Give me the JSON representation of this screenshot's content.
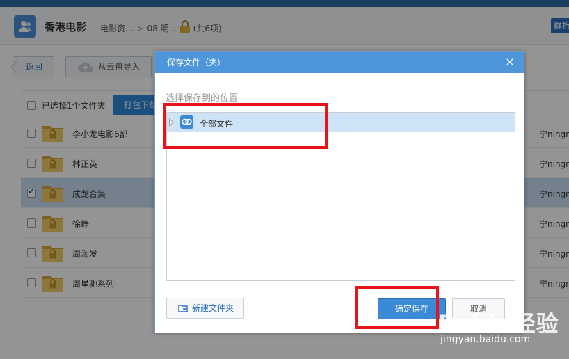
{
  "header": {
    "title": "香港电影",
    "breadcrumb": [
      "电影资...",
      "08.明..."
    ],
    "item_count": "(共6项)",
    "group_button": "群折"
  },
  "toolbar": {
    "back_label": "返回",
    "import_label": "从云盘导入"
  },
  "list": {
    "selected_text": "已选择1个文件夹",
    "pack_download": "打包下载",
    "rows": [
      {
        "name": "李小龙电影6部",
        "owner": "宁ningn",
        "checked": false
      },
      {
        "name": "林正英",
        "owner": "宁ningn",
        "checked": false
      },
      {
        "name": "成龙合集",
        "owner": "宁ningn",
        "checked": true
      },
      {
        "name": "徐峥",
        "owner": "宁ningn",
        "checked": false
      },
      {
        "name": "周润发",
        "owner": "宁ningn",
        "checked": false
      },
      {
        "name": "周星驰系列",
        "owner": "宁ningn",
        "checked": false
      }
    ]
  },
  "dialog": {
    "title": "保存文件（夹）",
    "close": "×",
    "subtitle": "选择保存到的位置",
    "tree_root": "全部文件",
    "new_folder": "新建文件夹",
    "confirm": "确定保存",
    "cancel": "取消"
  },
  "watermark": {
    "logo": "Baidu经验",
    "url": "jingyan.baidu.com"
  },
  "colors": {
    "accent": "#4d96d9",
    "highlight_box": "#e8141c",
    "selected_row": "#c9dcef"
  }
}
